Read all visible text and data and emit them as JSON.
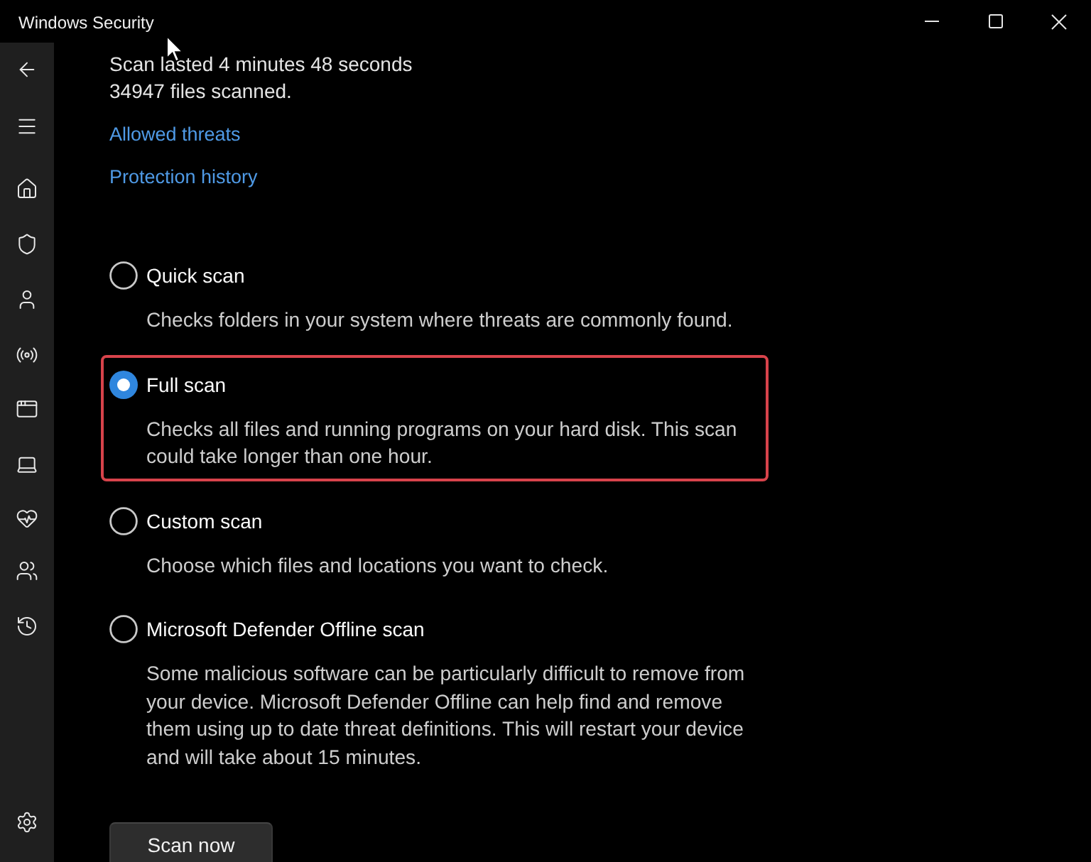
{
  "window": {
    "title": "Windows Security"
  },
  "scan_summary": [
    "Scan lasted 4 minutes 48 seconds",
    "34947 files scanned."
  ],
  "links": [
    "Allowed threats",
    "Protection history"
  ],
  "scan_options": [
    {
      "label": "Quick scan",
      "description": "Checks folders in your system where threats are commonly found.",
      "selected": false,
      "highlighted": false
    },
    {
      "label": "Full scan",
      "description": "Checks all files and running programs on your hard disk. This scan could take longer than one hour.",
      "selected": true,
      "highlighted": true
    },
    {
      "label": "Custom scan",
      "description": "Choose which files and locations you want to check.",
      "selected": false,
      "highlighted": false
    },
    {
      "label": "Microsoft Defender Offline scan",
      "description": "Some malicious software can be particularly difficult to remove from your device. Microsoft Defender Offline can help find and remove them using up to date threat definitions. This will restart your device and will take about 15 minutes.",
      "selected": false,
      "highlighted": false
    }
  ],
  "primary_button": "Scan now"
}
